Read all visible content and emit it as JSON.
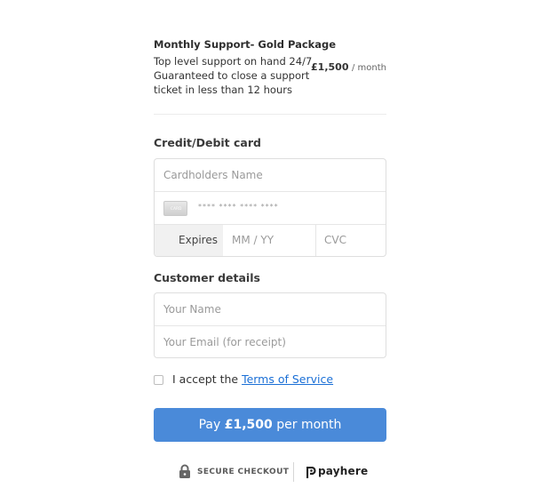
{
  "product": {
    "name": "Monthly Support- Gold Package",
    "description": "Top level support on hand 24/7. Guaranteed to close a support ticket in less than 12 hours",
    "price": "£1,500",
    "per": "/ month"
  },
  "card_section": {
    "title": "Credit/Debit card",
    "cardholder_placeholder": "Cardholders Name",
    "card_icon_label": "CARD",
    "card_number_placeholder": "**** **** **** ****",
    "expires_label": "Expires",
    "expiry_placeholder": "MM / YY",
    "cvc_placeholder": "CVC"
  },
  "customer_section": {
    "title": "Customer details",
    "name_placeholder": "Your Name",
    "email_placeholder": "Your Email (for receipt)"
  },
  "terms": {
    "prefix": "I accept the ",
    "link": "Terms of Service",
    "checked": false
  },
  "pay_button": {
    "prefix": "Pay ",
    "amount": "£1,500",
    "suffix": " per month",
    "color": "#4a8ad9"
  },
  "footer": {
    "secure_label": "SECURE CHECKOUT",
    "brand": "payhere",
    "secure_icon": "lock-icon",
    "brand_icon": "payhere-logo-icon"
  }
}
